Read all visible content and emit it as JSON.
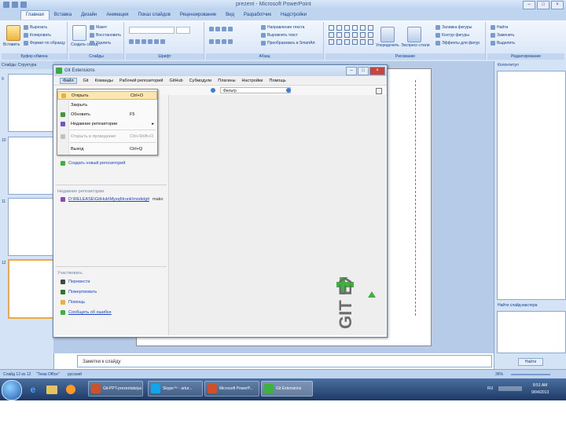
{
  "powerpoint": {
    "title": "prezent - Microsoft PowerPoint",
    "tabs": [
      "Главная",
      "Вставка",
      "Дизайн",
      "Анимация",
      "Показ слайдов",
      "Рецензирование",
      "Вид",
      "Разработчик",
      "Надстройки"
    ],
    "active_tab": "Главная",
    "clipboard": {
      "paste": "Вставить",
      "cut": "Вырезать",
      "copy": "Копировать",
      "format": "Формат по образцу",
      "label": "Буфер обмена"
    },
    "slides_group": {
      "create": "Создать слайд",
      "layout": "Макет",
      "reset": "Восстановить",
      "delete": "Удалить",
      "label": "Слайды"
    },
    "font_group": {
      "label": "Шрифт"
    },
    "paragraph_group": {
      "text_direction": "Направление текста",
      "align_text": "Выровнять текст",
      "smartart": "Преобразовать в SmartArt",
      "label": "Абзац"
    },
    "drawing_group": {
      "arrange": "Упорядочить",
      "quick_styles": "Экспресс-стили",
      "fill": "Заливка фигуры",
      "outline": "Контур фигуры",
      "effects": "Эффекты для фигур",
      "label": "Рисование"
    },
    "editing_group": {
      "find": "Найти",
      "replace": "Заменить",
      "select": "Выделить",
      "label": "Редактирование"
    },
    "left_tabs": [
      "Слайды",
      "Структура"
    ],
    "slide_numbers": [
      "9",
      "10",
      "11",
      "12"
    ],
    "notes_placeholder": "Заметки к слайду",
    "right_pane_title": "Колонтитул",
    "right_pane_section": "Найти слайд-мастера",
    "right_pane_button": "Найти",
    "status": {
      "slide": "Слайд 12 из 12",
      "theme": "\"Тема Office\"",
      "lang": "русский",
      "zoom": "36%"
    }
  },
  "taskbar": {
    "buttons": [
      "Git-PPT-prezentatsiya",
      "Skype™ - artur...",
      "Microsoft PowerP...",
      "Git Extensions"
    ],
    "tray_lang": "RU",
    "time": "8:51 AM",
    "date": "9/04/2013"
  },
  "gitext": {
    "title": "Git Extensions",
    "menu": [
      "Файл",
      "Git",
      "Команды",
      "Рабочий репозиторий",
      "GitHub",
      "Субмодули",
      "Плагины",
      "Настройки",
      "Помощь"
    ],
    "active_menu": "Файл",
    "branch_placeholder": "Фильтр",
    "dropdown": [
      {
        "label": "Открыть",
        "shortcut": "Ctrl+O",
        "icon": "open-folder-icon",
        "color": "#e8b338",
        "highlight": true
      },
      {
        "label": "Закрыть",
        "shortcut": "",
        "icon": "",
        "color": "",
        "highlight": false
      },
      {
        "label": "Обновить",
        "shortcut": "F5",
        "icon": "refresh-icon",
        "color": "#3a9a3a",
        "highlight": false
      },
      {
        "label": "Недавние репозитории",
        "shortcut": "",
        "icon": "recent-icon",
        "color": "#6b58c8",
        "highlight": false
      },
      {
        "label": "Открыть в проводнике",
        "shortcut": "Ctrl+Shift+O",
        "icon": "explorer-icon",
        "color": "#c0c0c0",
        "highlight": false,
        "disabled": true
      },
      {
        "label": "Выход",
        "shortcut": "Ctrl+Q",
        "icon": "",
        "color": "",
        "highlight": false
      }
    ],
    "left": {
      "clone_link": "Создать новый репозиторий",
      "recent_header": "Недавние репозитории",
      "recent_repo": "D:\\RELEASE\\GitHub\\Mysql\\trunk\\modelgit",
      "recent_repo_extra": "mako",
      "support_header": "Участвовать",
      "links": [
        "Перевести",
        "Пожертвовать",
        "Помощь",
        "Сообщить об ошибке"
      ]
    },
    "logo_text": "GIT EXT",
    "colors": {
      "logo_green": "#3db33d",
      "logo_gray": "#6d6d6d"
    }
  }
}
